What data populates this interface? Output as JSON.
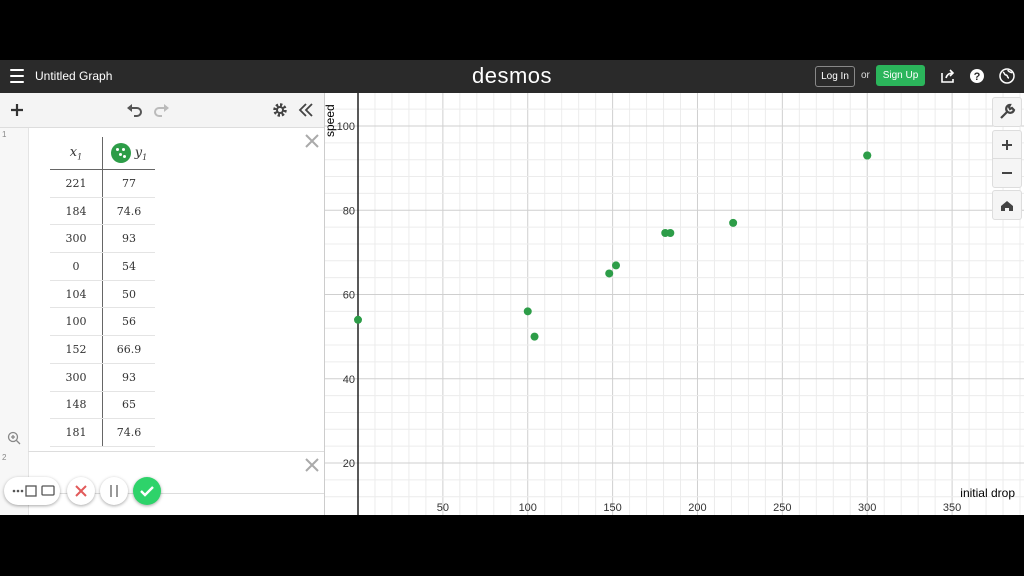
{
  "header": {
    "graph_title": "Untitled Graph",
    "logo": "desmos",
    "login_label": "Log In",
    "or_text": "or",
    "signup_label": "Sign Up",
    "icons": [
      "menu-icon",
      "share-icon",
      "help-icon",
      "globe-icon"
    ]
  },
  "panel": {
    "toolbar_icons": [
      "add-icon",
      "undo-icon",
      "redo-icon",
      "settings-icon",
      "collapse-icon"
    ],
    "expression_numbers": [
      "1",
      "2"
    ],
    "table": {
      "headers": [
        {
          "var": "x",
          "sub": "1"
        },
        {
          "var": "y",
          "sub": "1"
        }
      ],
      "rows": [
        [
          "221",
          "77"
        ],
        [
          "184",
          "74.6"
        ],
        [
          "300",
          "93"
        ],
        [
          "0",
          "54"
        ],
        [
          "104",
          "50"
        ],
        [
          "100",
          "56"
        ],
        [
          "152",
          "66.9"
        ],
        [
          "300",
          "93"
        ],
        [
          "148",
          "65"
        ],
        [
          "181",
          "74.6"
        ]
      ]
    },
    "bottom_buttons": [
      "keypad-icon",
      "cancel-icon",
      "pause-icon",
      "confirm-icon"
    ]
  },
  "chart_data": {
    "type": "scatter",
    "xlabel": "initial drop",
    "ylabel": "speed",
    "xlim": [
      0,
      390
    ],
    "ylim": [
      12,
      106
    ],
    "x_ticks": [
      50,
      100,
      150,
      200,
      250,
      300,
      350
    ],
    "y_ticks": [
      20,
      40,
      60,
      80,
      100
    ],
    "grid": true,
    "point_color": "#2d9d48",
    "points": [
      {
        "x": 221,
        "y": 77
      },
      {
        "x": 184,
        "y": 74.6
      },
      {
        "x": 300,
        "y": 93
      },
      {
        "x": 0,
        "y": 54
      },
      {
        "x": 104,
        "y": 50
      },
      {
        "x": 100,
        "y": 56
      },
      {
        "x": 152,
        "y": 66.9
      },
      {
        "x": 300,
        "y": 93
      },
      {
        "x": 148,
        "y": 65
      },
      {
        "x": 181,
        "y": 74.6
      }
    ]
  },
  "graph_tools": [
    "wrench-icon",
    "zoom-in-icon",
    "zoom-out-icon",
    "home-icon"
  ]
}
